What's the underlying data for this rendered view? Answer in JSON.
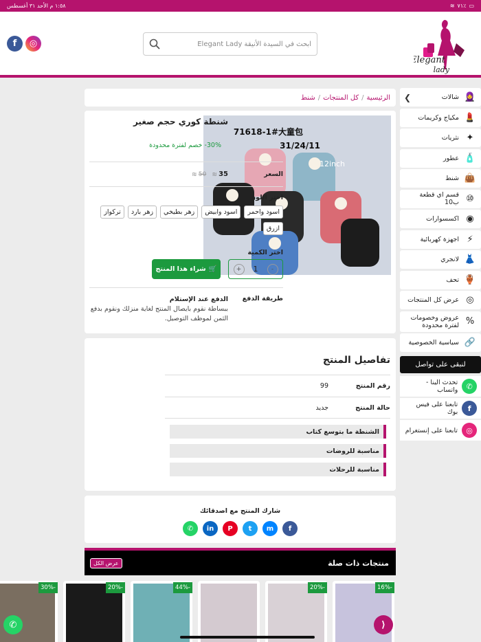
{
  "status": {
    "time": "١:٥٨ م",
    "date": "الأحد ٣١ أغسطس",
    "battery": "٧١٪"
  },
  "search": {
    "placeholder": "ابحث في السيدة الأنيقة Elegant Lady"
  },
  "logo": {
    "text1": "Elegant",
    "text2": "lady"
  },
  "sidebar": {
    "items": [
      {
        "label": "شالات",
        "icon": "scarf-woman-icon"
      },
      {
        "label": "مكياج وكريمات",
        "icon": "cosmetics-icon"
      },
      {
        "label": "نثريات",
        "icon": "misc-items-icon"
      },
      {
        "label": "عطور",
        "icon": "perfume-icon"
      },
      {
        "label": "شنط",
        "icon": "bag-icon"
      },
      {
        "label": "قسم اي قطعة ب10",
        "icon": "ten-badge-icon"
      },
      {
        "label": "اكسسوارات",
        "icon": "necklace-icon"
      },
      {
        "label": "اجهزة كهربائية",
        "icon": "electronics-icon"
      },
      {
        "label": "لانجري",
        "icon": "dress-icon"
      },
      {
        "label": "تحف",
        "icon": "antiques-icon"
      },
      {
        "label": "عرض كل المنتجات",
        "icon": "eye-icon"
      },
      {
        "label": "عروض وخصومات لفترة محدودة",
        "icon": "discount-icon"
      },
      {
        "label": "سياسية الخصوصية",
        "icon": "link-icon"
      }
    ],
    "contact_title": "لنبقى على تواصل",
    "contacts": [
      {
        "label": "تحدث الينا - واتساب",
        "icon": "whatsapp-icon",
        "color": "#25d366",
        "glyph": "✆"
      },
      {
        "label": "تابعنا على فيس بوك",
        "icon": "facebook-icon",
        "color": "#3b5998",
        "glyph": "f"
      },
      {
        "label": "تابعنا على إنستغرام",
        "icon": "instagram-icon",
        "color": "#e5267b",
        "glyph": "◎"
      }
    ]
  },
  "breadcrumb": {
    "home": "الرئيسية",
    "all": "كل المنتجات",
    "current": "شنط"
  },
  "product": {
    "title": "شنطة كوري حجم صغير",
    "discount": "30%- خصم لفترة محدودة",
    "price_label": "السعر",
    "price_now": "35",
    "price_old": "50",
    "currency": "₪",
    "color_label": "اختر اللون",
    "colors": [
      "اسود واحمر",
      "اسود وابيض",
      "زهر بطيخي",
      "زهر بارد",
      "تركواز",
      "ازرق"
    ],
    "qty_label": "اختر الكمية",
    "qty": "1",
    "buy_label": "شراء هذا المنتج",
    "pay_label": "طريقة الدفع",
    "pay_title": "الدفع عند الإستلام",
    "pay_desc": "ببساطة نقوم بايصال المنتج لغاية منزلك ونقوم بدفع الثمن لموظف التوصيل.",
    "image_text": {
      "line1": "71618-1#大童包",
      "line2": "31/24/11",
      "line3": "12inch"
    }
  },
  "details": {
    "title": "تفاصيل المنتج",
    "rows": [
      {
        "k": "رقم المنتج",
        "v": "99"
      },
      {
        "k": "حالة المنتج",
        "v": "جديد"
      }
    ],
    "features": [
      "الشنطة ما بتوسع كتاب",
      "مناسبة للروضات",
      "مناسبة للرحلات"
    ]
  },
  "share": {
    "title": "شارك المنتج مع اصدقائك"
  },
  "related": {
    "title": "منتجات ذات صلة",
    "view_all": "عرض الكل",
    "cards": [
      {
        "badge": "-16%",
        "color": "#c7c3dd"
      },
      {
        "badge": "-20%",
        "color": "#d9d1d6"
      },
      {
        "badge": "",
        "color": "#d4cad0"
      },
      {
        "badge": "-44%",
        "color": "#6fb0b5"
      },
      {
        "badge": "-20%",
        "color": "#1a1a1a"
      },
      {
        "badge": "-30%",
        "color": "#7a6e60"
      }
    ]
  },
  "colors": {
    "brand": "#b5136d",
    "green": "#1c9a3e"
  }
}
